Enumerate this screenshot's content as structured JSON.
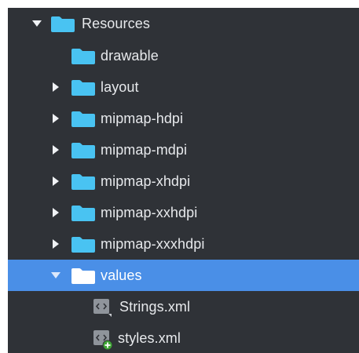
{
  "colors": {
    "panel_bg": "#2f3237",
    "folder_blue": "#49c3f2",
    "selected_row": "#4a8fe7",
    "text": "#e7e9ec",
    "add_badge": "#3fa535"
  },
  "tree": {
    "root": {
      "label": "Resources",
      "expanded": true,
      "icon": "folder-icon"
    },
    "children": [
      {
        "label": "drawable",
        "has_children": false,
        "icon": "folder-icon"
      },
      {
        "label": "layout",
        "has_children": true,
        "expanded": false,
        "icon": "folder-icon"
      },
      {
        "label": "mipmap-hdpi",
        "has_children": true,
        "expanded": false,
        "icon": "folder-icon"
      },
      {
        "label": "mipmap-mdpi",
        "has_children": true,
        "expanded": false,
        "icon": "folder-icon"
      },
      {
        "label": "mipmap-xhdpi",
        "has_children": true,
        "expanded": false,
        "icon": "folder-icon"
      },
      {
        "label": "mipmap-xxhdpi",
        "has_children": true,
        "expanded": false,
        "icon": "folder-icon"
      },
      {
        "label": "mipmap-xxxhdpi",
        "has_children": true,
        "expanded": false,
        "icon": "folder-icon"
      },
      {
        "label": "values",
        "has_children": true,
        "expanded": true,
        "selected": true,
        "icon": "folder-icon",
        "files": [
          {
            "label": "Strings.xml",
            "icon": "xml-file-icon"
          },
          {
            "label": "styles.xml",
            "icon": "xml-file-add-icon"
          }
        ]
      }
    ]
  }
}
